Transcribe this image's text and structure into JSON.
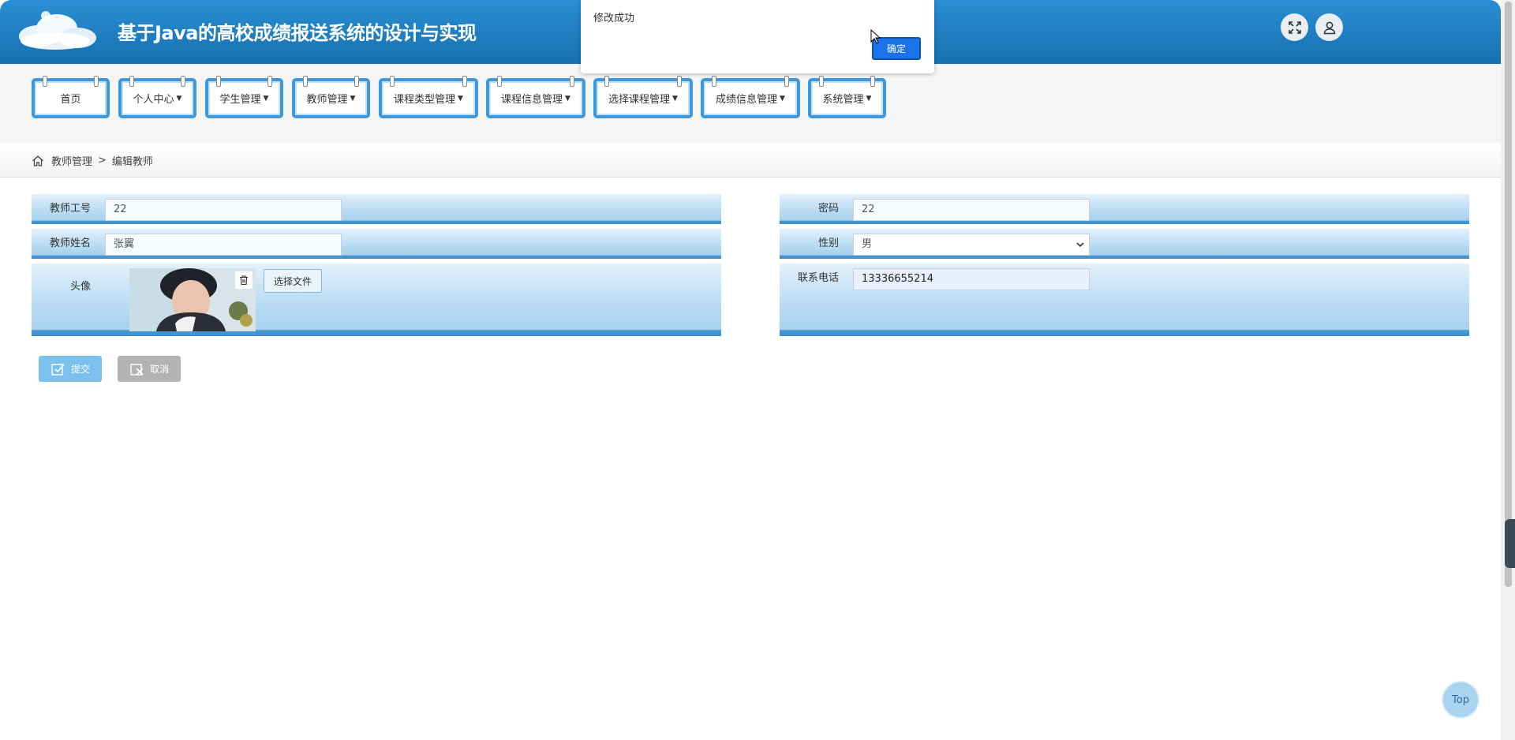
{
  "header": {
    "title": "基于Java的高校成绩报送系统的设计与实现",
    "fullscreen_icon": "expand-icon",
    "user_icon": "user-icon"
  },
  "nav": {
    "items": [
      {
        "label": "首页",
        "dropdown": false
      },
      {
        "label": "个人中心",
        "dropdown": true
      },
      {
        "label": "学生管理",
        "dropdown": true
      },
      {
        "label": "教师管理",
        "dropdown": true
      },
      {
        "label": "课程类型管理",
        "dropdown": true
      },
      {
        "label": "课程信息管理",
        "dropdown": true
      },
      {
        "label": "选择课程管理",
        "dropdown": true
      },
      {
        "label": "成绩信息管理",
        "dropdown": true
      },
      {
        "label": "系统管理",
        "dropdown": true
      }
    ]
  },
  "breadcrumb": {
    "section": "教师管理",
    "separator": ">",
    "page": "编辑教师"
  },
  "form": {
    "teacher_id": {
      "label": "教师工号",
      "value": "22"
    },
    "password": {
      "label": "密码",
      "value": "22"
    },
    "teacher_name": {
      "label": "教师姓名",
      "value": "张翼"
    },
    "gender": {
      "label": "性别",
      "value": "男"
    },
    "avatar": {
      "label": "头像",
      "choose_file": "选择文件"
    },
    "phone": {
      "label": "联系电话",
      "value": "13336655214"
    }
  },
  "actions": {
    "submit": "提交",
    "cancel": "取消"
  },
  "alert": {
    "message": "修改成功",
    "ok": "确定"
  },
  "back_to_top": "Top",
  "colors": {
    "header": "#1f82c6",
    "nav_border": "#3f97dc",
    "form_band": "#b6daf2",
    "alert_button": "#1a73e8"
  }
}
